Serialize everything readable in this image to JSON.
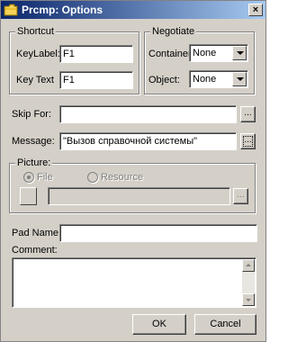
{
  "window": {
    "title": "Prcmp: Options",
    "close_glyph": "×",
    "icon": "folder-icon"
  },
  "shortcut": {
    "legend": "Shortcut",
    "key_label_label": "KeyLabel:",
    "key_label_value": "F1",
    "key_text_label": "Key Text",
    "key_text_value": "F1"
  },
  "negotiate": {
    "legend": "Negotiate",
    "container_label": "Container",
    "container_value": "None",
    "object_label": "Object:",
    "object_value": "None"
  },
  "skip_for": {
    "label": "Skip For:",
    "value": "",
    "browse_label": "..."
  },
  "message": {
    "label": "Message:",
    "value": "\"Вызов справочной системы\"",
    "browse_label": "..."
  },
  "picture": {
    "legend": "Picture:",
    "file_label": "File",
    "resource_label": "Resource",
    "selected": "File",
    "value": "",
    "browse_label": "..."
  },
  "pad_name": {
    "label": "Pad Name:",
    "value": ""
  },
  "comment": {
    "label": "Comment:",
    "value": ""
  },
  "buttons": {
    "ok": "OK",
    "cancel": "Cancel"
  }
}
